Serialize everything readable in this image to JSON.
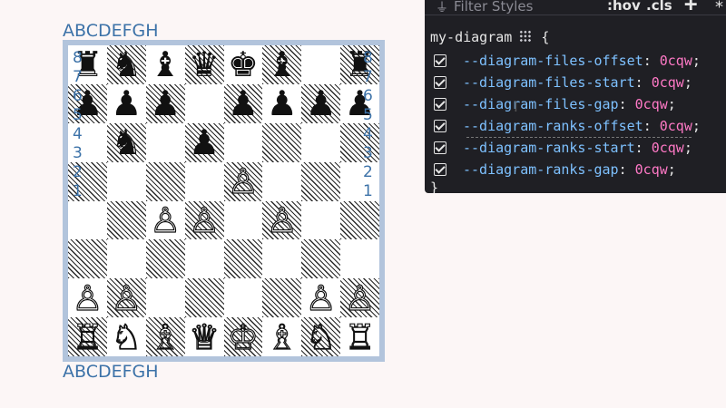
{
  "diagram": {
    "files_top": "ABCDEFGH",
    "files_bottom": "ABCDEFGH",
    "ranks_left": [
      "8",
      "7",
      "6",
      "5",
      "4",
      "3",
      "2",
      "1"
    ],
    "ranks_right": [
      "8",
      "7",
      "6",
      "5",
      "4",
      "3",
      "2",
      "1"
    ],
    "board": [
      [
        "♜",
        "♞",
        "♝",
        "♛",
        "♚",
        "♝",
        "",
        "♜"
      ],
      [
        "♟",
        "♟",
        "♟",
        "",
        "♟",
        "♟",
        "♟",
        "♟"
      ],
      [
        "",
        "♞",
        "",
        "♟",
        "",
        "",
        "",
        ""
      ],
      [
        "",
        "",
        "",
        "",
        "♙",
        "",
        "",
        ""
      ],
      [
        "",
        "",
        "♙",
        "♙",
        "",
        "♙",
        "",
        ""
      ],
      [
        "",
        "",
        "",
        "",
        "",
        "",
        "",
        ""
      ],
      [
        "♙",
        "♙",
        "",
        "",
        "",
        "",
        "♙",
        "♙"
      ],
      [
        "♖",
        "♘",
        "♗",
        "♕",
        "♔",
        "♗",
        "♘",
        "♖"
      ]
    ],
    "colors": {
      "label": "#3c72a8",
      "frame": "#b2c4dc"
    }
  },
  "devtools": {
    "filter_placeholder": "Filter Styles",
    "hov_label": ":hov",
    "cls_label": ".cls",
    "plus_label": "+",
    "selector": "my-diagram",
    "open_brace": "{",
    "close_brace": "}",
    "declarations": [
      {
        "prop": "--diagram-files-offset",
        "value": "0cqw"
      },
      {
        "prop": "--diagram-files-start",
        "value": "0cqw"
      },
      {
        "prop": "--diagram-files-gap",
        "value": "0cqw"
      },
      {
        "prop": "--diagram-ranks-offset",
        "value": "0cqw"
      },
      {
        "prop": "--diagram-ranks-start",
        "value": "0cqw"
      },
      {
        "prop": "--diagram-ranks-gap",
        "value": "0cqw"
      }
    ],
    "colors": {
      "background": "#1f1f24",
      "property": "#7ec1ff",
      "value": "#ff79c6"
    }
  }
}
